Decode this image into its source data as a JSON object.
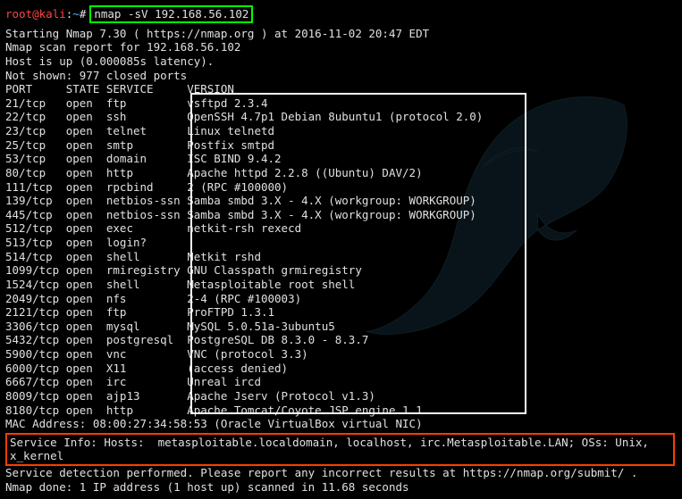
{
  "prompt": {
    "user": "root",
    "at": "@",
    "host": "kali",
    "colon": ":",
    "path": "~",
    "hash": "#"
  },
  "command": "nmap -sV 192.168.56.102",
  "preamble": {
    "line1": "Starting Nmap 7.30 ( https://nmap.org ) at 2016-11-02 20:47 EDT",
    "line2": "Nmap scan report for 192.168.56.102",
    "line3": "Host is up (0.000085s latency).",
    "line4": "Not shown: 977 closed ports"
  },
  "header": "PORT     STATE SERVICE     VERSION",
  "ports": [
    "21/tcp   open  ftp         vsftpd 2.3.4",
    "22/tcp   open  ssh         OpenSSH 4.7p1 Debian 8ubuntu1 (protocol 2.0)",
    "23/tcp   open  telnet      Linux telnetd",
    "25/tcp   open  smtp        Postfix smtpd",
    "53/tcp   open  domain      ISC BIND 9.4.2",
    "80/tcp   open  http        Apache httpd 2.2.8 ((Ubuntu) DAV/2)",
    "111/tcp  open  rpcbind     2 (RPC #100000)",
    "139/tcp  open  netbios-ssn Samba smbd 3.X - 4.X (workgroup: WORKGROUP)",
    "445/tcp  open  netbios-ssn Samba smbd 3.X - 4.X (workgroup: WORKGROUP)",
    "512/tcp  open  exec        netkit-rsh rexecd",
    "513/tcp  open  login?",
    "514/tcp  open  shell       Netkit rshd",
    "1099/tcp open  rmiregistry GNU Classpath grmiregistry",
    "1524/tcp open  shell       Metasploitable root shell",
    "2049/tcp open  nfs         2-4 (RPC #100003)",
    "2121/tcp open  ftp         ProFTPD 1.3.1",
    "3306/tcp open  mysql       MySQL 5.0.51a-3ubuntu5",
    "5432/tcp open  postgresql  PostgreSQL DB 8.3.0 - 8.3.7",
    "5900/tcp open  vnc         VNC (protocol 3.3)",
    "6000/tcp open  X11         (access denied)",
    "6667/tcp open  irc         Unreal ircd",
    "8009/tcp open  ajp13       Apache Jserv (Protocol v1.3)",
    "8180/tcp open  http        Apache Tomcat/Coyote JSP engine 1.1"
  ],
  "mac": "MAC Address: 08:00:27:34:58:53 (Oracle VirtualBox virtual NIC)",
  "service_info": "Service Info: Hosts:  metasploitable.localdomain, localhost, irc.Metasploitable.LAN; OSs: Unix,\nx_kernel",
  "footer": {
    "line1": "Service detection performed. Please report any incorrect results at https://nmap.org/submit/ .",
    "line2": "Nmap done: 1 IP address (1 host up) scanned in 11.68 seconds"
  }
}
